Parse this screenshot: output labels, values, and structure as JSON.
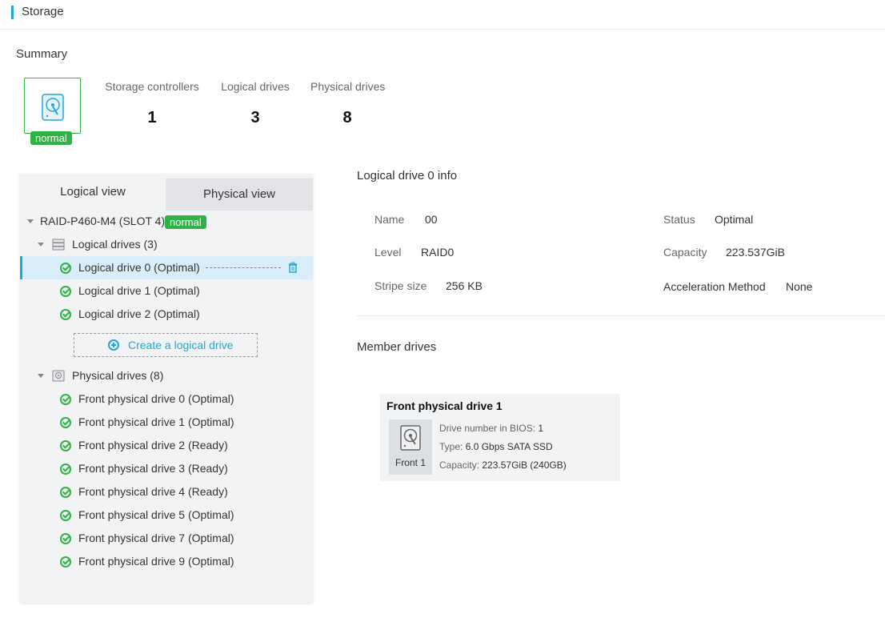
{
  "header": {
    "title": "Storage"
  },
  "summary": {
    "title": "Summary",
    "status_badge": "normal",
    "stats": [
      {
        "label": "Storage controllers",
        "value": "1"
      },
      {
        "label": "Logical drives",
        "value": "3"
      },
      {
        "label": "Physical drives",
        "value": "8"
      }
    ]
  },
  "tabs": {
    "logical": "Logical view",
    "physical": "Physical view"
  },
  "tree": {
    "controller": {
      "label": "RAID-P460-M4 (SLOT 4)",
      "badge": "normal"
    },
    "logical_group": "Logical drives (3)",
    "logical_drives": [
      "Logical drive 0 (Optimal)",
      "Logical drive 1 (Optimal)",
      "Logical drive 2 (Optimal)"
    ],
    "create_button": "Create a logical drive",
    "physical_group": "Physical drives (8)",
    "physical_drives": [
      "Front physical drive 0 (Optimal)",
      "Front physical drive 1 (Optimal)",
      "Front physical drive 2 (Ready)",
      "Front physical drive 3 (Ready)",
      "Front physical drive 4 (Ready)",
      "Front physical drive 5 (Optimal)",
      "Front physical drive 7 (Optimal)",
      "Front physical drive 9 (Optimal)"
    ]
  },
  "info": {
    "title": "Logical drive 0 info",
    "name_label": "Name",
    "name_value": "00",
    "level_label": "Level",
    "level_value": "RAID0",
    "stripe_label": "Stripe size",
    "stripe_value": "256 KB",
    "status_label": "Status",
    "status_value": "Optimal",
    "capacity_label": "Capacity",
    "capacity_value": "223.537GiB",
    "accel_label": "Acceleration Method",
    "accel_value": "None"
  },
  "members": {
    "title": "Member drives",
    "card": {
      "title": "Front physical drive 1",
      "thumb_label": "Front 1",
      "bios_label": "Drive number in BIOS: ",
      "bios_value": "1",
      "type_label": "Type: ",
      "type_value": "6.0 Gbps SATA SSD",
      "capacity_label": "Capacity: ",
      "capacity_value": "223.57GiB (240GB)"
    }
  },
  "colors": {
    "accent": "#1ba8e0",
    "ok_green": "#2fb344",
    "panel_bg": "#f2f3f5"
  },
  "icons": [
    "hard-disk-icon",
    "check-circle-icon",
    "trash-icon",
    "add-circle-icon",
    "server-icon",
    "caret-down-icon"
  ]
}
